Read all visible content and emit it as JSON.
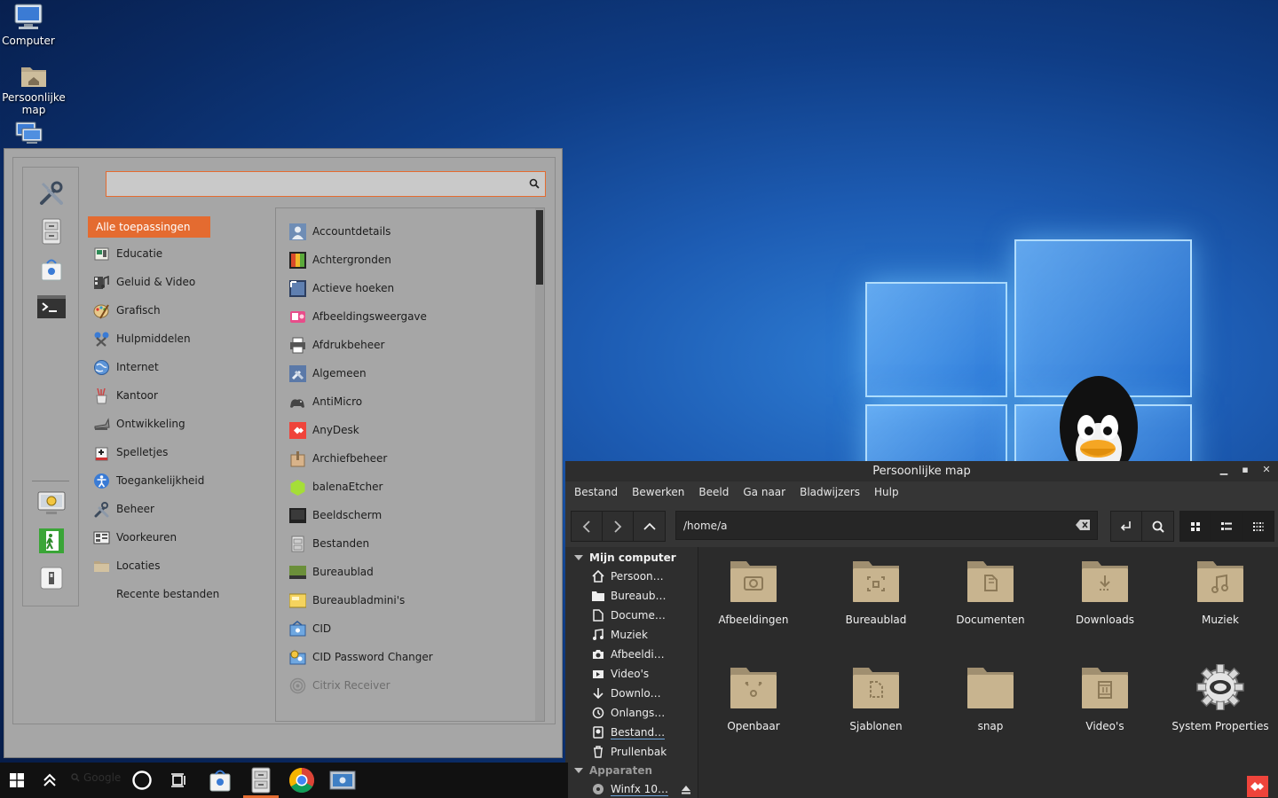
{
  "desktop": {
    "icons": [
      {
        "label": "Computer",
        "icon": "monitor-icon"
      },
      {
        "label": "Persoonlijke map",
        "icon": "home-folder-icon"
      },
      {
        "label": "",
        "icon": "network-icon"
      }
    ]
  },
  "start_menu": {
    "search": {
      "value": "",
      "placeholder": ""
    },
    "categories": [
      {
        "label": "Alle toepassingen",
        "selected": true
      },
      {
        "label": "Educatie",
        "icon": "education-icon"
      },
      {
        "label": "Geluid & Video",
        "icon": "multimedia-icon"
      },
      {
        "label": "Grafisch",
        "icon": "graphics-icon"
      },
      {
        "label": "Hulpmiddelen",
        "icon": "accessories-icon"
      },
      {
        "label": "Internet",
        "icon": "internet-icon"
      },
      {
        "label": "Kantoor",
        "icon": "office-icon"
      },
      {
        "label": "Ontwikkeling",
        "icon": "development-icon"
      },
      {
        "label": "Spelletjes",
        "icon": "games-icon"
      },
      {
        "label": "Toegankelijkheid",
        "icon": "accessibility-icon"
      },
      {
        "label": "Beheer",
        "icon": "administration-icon"
      },
      {
        "label": "Voorkeuren",
        "icon": "preferences-icon"
      },
      {
        "label": "Locaties",
        "icon": "places-folder-icon"
      },
      {
        "label": "Recente bestanden"
      }
    ],
    "apps": [
      {
        "label": "Accountdetails",
        "icon": "account-icon"
      },
      {
        "label": "Achtergronden",
        "icon": "backgrounds-icon"
      },
      {
        "label": "Actieve hoeken",
        "icon": "hot-corners-icon"
      },
      {
        "label": "Afbeeldingsweergave",
        "icon": "image-viewer-icon"
      },
      {
        "label": "Afdrukbeheer",
        "icon": "printer-icon"
      },
      {
        "label": "Algemeen",
        "icon": "general-settings-icon"
      },
      {
        "label": "AntiMicro",
        "icon": "gamepad-icon"
      },
      {
        "label": "AnyDesk",
        "icon": "anydesk-icon"
      },
      {
        "label": "Archiefbeheer",
        "icon": "archive-icon"
      },
      {
        "label": "balenaEtcher",
        "icon": "etcher-icon"
      },
      {
        "label": "Beeldscherm",
        "icon": "display-icon"
      },
      {
        "label": "Bestanden",
        "icon": "files-icon"
      },
      {
        "label": "Bureaublad",
        "icon": "desktop-icon"
      },
      {
        "label": "Bureaubladmini's",
        "icon": "desklets-icon"
      },
      {
        "label": "CID",
        "icon": "cid-icon"
      },
      {
        "label": "CID Password Changer",
        "icon": "cid-password-icon"
      },
      {
        "label": "Citrix Receiver",
        "icon": "citrix-icon"
      }
    ]
  },
  "file_manager": {
    "title": "Persoonlijke map",
    "menu": [
      "Bestand",
      "Bewerken",
      "Beeld",
      "Ga naar",
      "Bladwijzers",
      "Hulp"
    ],
    "path": "/home/a",
    "sidebar": {
      "computer_header": "Mijn computer",
      "computer_items": [
        {
          "label": "Persoon…",
          "icon": "home-icon"
        },
        {
          "label": "Bureaub…",
          "icon": "folder-icon"
        },
        {
          "label": "Docume…",
          "icon": "document-icon"
        },
        {
          "label": "Muziek",
          "icon": "music-icon"
        },
        {
          "label": "Afbeeldi…",
          "icon": "camera-icon"
        },
        {
          "label": "Video's",
          "icon": "video-icon"
        },
        {
          "label": "Downlo…",
          "icon": "download-icon"
        },
        {
          "label": "Onlangs…",
          "icon": "recent-icon"
        },
        {
          "label": "Bestand…",
          "icon": "filesystem-icon"
        },
        {
          "label": "Prullenbak",
          "icon": "trash-icon"
        }
      ],
      "devices_header": "Apparaten",
      "devices": [
        {
          "label": "Winfx 10…",
          "icon": "disc-icon"
        }
      ]
    },
    "items": [
      {
        "label": "Afbeeldingen",
        "icon": "pictures-folder-icon"
      },
      {
        "label": "Bureaublad",
        "icon": "desktop-folder-icon"
      },
      {
        "label": "Documenten",
        "icon": "documents-folder-icon"
      },
      {
        "label": "Downloads",
        "icon": "downloads-folder-icon"
      },
      {
        "label": "Muziek",
        "icon": "music-folder-icon"
      },
      {
        "label": "Openbaar",
        "icon": "public-folder-icon"
      },
      {
        "label": "Sjablonen",
        "icon": "templates-folder-icon"
      },
      {
        "label": "snap",
        "icon": "folder-icon"
      },
      {
        "label": "Video's",
        "icon": "videos-folder-icon"
      },
      {
        "label": "System Properties",
        "icon": "system-properties-gear-icon"
      }
    ]
  },
  "taskbar": {
    "search_label": "Google",
    "colors": {
      "accent": "#e46b30",
      "taskbar": "#111111"
    }
  }
}
